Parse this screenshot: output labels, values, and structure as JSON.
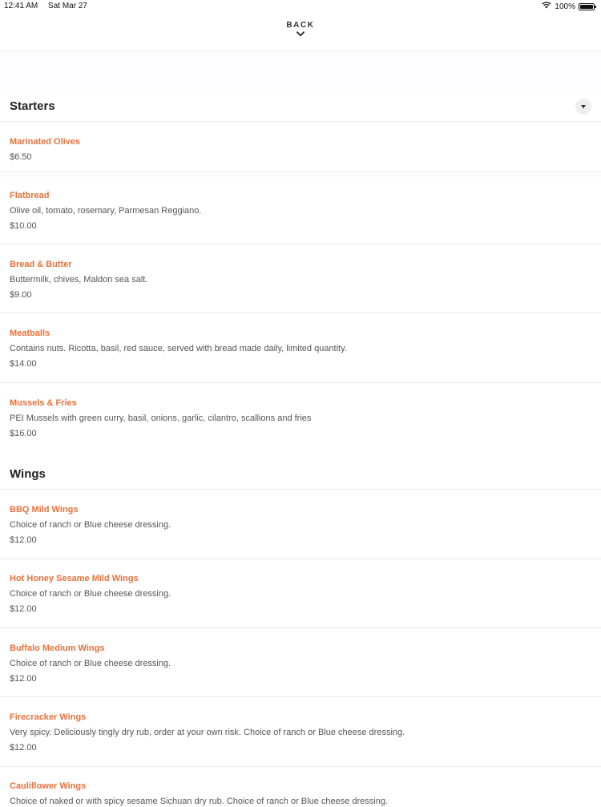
{
  "status_bar": {
    "time": "12:41 AM",
    "date": "Sat Mar 27",
    "battery": "100%"
  },
  "header": {
    "back_label": "BACK"
  },
  "sections": [
    {
      "title": "Starters",
      "items": [
        {
          "name": "Marinated Olives",
          "description": "",
          "price": "$6.50"
        },
        {
          "name": "Flatbread",
          "description": "Olive oil, tomato, rosemary, Parmesan Reggiano.",
          "price": "$10.00"
        },
        {
          "name": "Bread & Butter",
          "description": "Buttermilk, chives, Maldon sea salt.",
          "price": "$9.00"
        },
        {
          "name": "Meatballs",
          "description": "Contains nuts. Ricotta, basil, red sauce, served with bread made daily, limited quantity.",
          "price": "$14.00"
        },
        {
          "name": "Mussels & Fries",
          "description": "PEI Mussels with green curry, basil, onions, garlic, cilantro, scallions and fries",
          "price": "$16.00"
        }
      ]
    },
    {
      "title": "Wings",
      "items": [
        {
          "name": "BBQ Mild Wings",
          "description": "Choice of ranch or Blue cheese dressing.",
          "price": "$12.00"
        },
        {
          "name": "Hot Honey Sesame Mild Wings",
          "description": "Choice of ranch or Blue cheese dressing.",
          "price": "$12.00"
        },
        {
          "name": "Buffalo Medium Wings",
          "description": "Choice of ranch or Blue cheese dressing.",
          "price": "$12.00"
        },
        {
          "name": "Firecracker Wings",
          "description": "Very spicy. Deliciously tingly dry rub, order at your own risk. Choice of ranch or Blue cheese dressing.",
          "price": "$12.00"
        },
        {
          "name": "Cauliflower Wings",
          "description": "Choice of naked or with spicy sesame Sichuan dry rub. Choice of ranch or Blue cheese dressing.",
          "price": ""
        }
      ]
    }
  ],
  "colors": {
    "item_name": "#e8703a",
    "text": "#555555",
    "divider": "#ececec"
  }
}
